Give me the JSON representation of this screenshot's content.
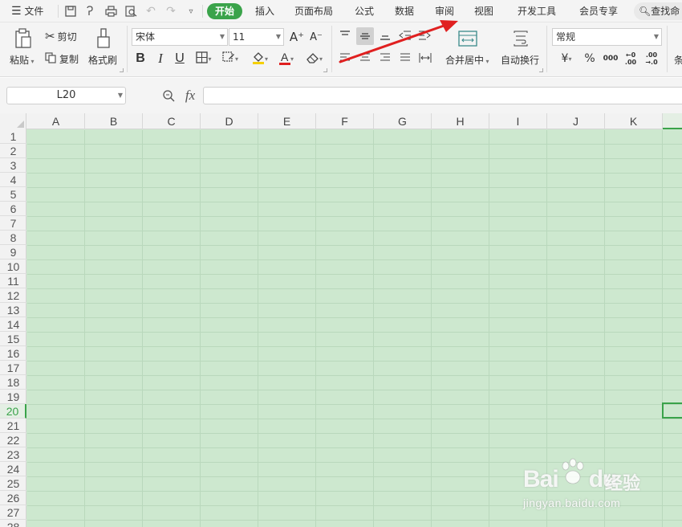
{
  "menubar": {
    "menu_label": "文件",
    "tabs": [
      "开始",
      "插入",
      "页面布局",
      "公式",
      "数据",
      "审阅",
      "视图",
      "开发工具",
      "会员专享"
    ],
    "active_tab": "开始",
    "search_label": "查找命"
  },
  "ribbon": {
    "paste": "粘贴",
    "cut": "剪切",
    "copy": "复制",
    "format_painter": "格式刷",
    "font_name": "宋体",
    "font_size": "11",
    "bold": "B",
    "italic": "I",
    "underline": "U",
    "font_color_glyph": "A",
    "merge_center": "合并居中",
    "wrap_text": "自动换行",
    "number_format": "常规",
    "currency": "¥",
    "percent": "%",
    "thousands": "000",
    "inc_decimal_top": "←0",
    "inc_decimal_bottom": ".00",
    "dec_decimal_top": ".00",
    "dec_decimal_bottom": "→.0",
    "cond_format_partial": "条"
  },
  "formula_bar": {
    "name_box": "L20",
    "fx_label": "fx",
    "formula_value": ""
  },
  "sheet": {
    "columns": [
      "A",
      "B",
      "C",
      "D",
      "E",
      "F",
      "G",
      "H",
      "I",
      "J",
      "K"
    ],
    "rows": [
      "1",
      "2",
      "3",
      "4",
      "5",
      "6",
      "7",
      "8",
      "9",
      "10",
      "11",
      "12",
      "13",
      "14",
      "15",
      "16",
      "17",
      "18",
      "19",
      "20",
      "21",
      "22",
      "23",
      "24",
      "25",
      "26",
      "27",
      "28"
    ],
    "selected_row": "20",
    "selected_cell": "L20",
    "eye_protection_color": "#cde8cf"
  },
  "colors": {
    "accent": "#3aa34a",
    "annotation_arrow": "#e02020"
  },
  "watermark": {
    "logo_text_1": "Bai",
    "logo_text_2": "du",
    "brand": "经验",
    "url": "jingyan.baidu.com"
  }
}
